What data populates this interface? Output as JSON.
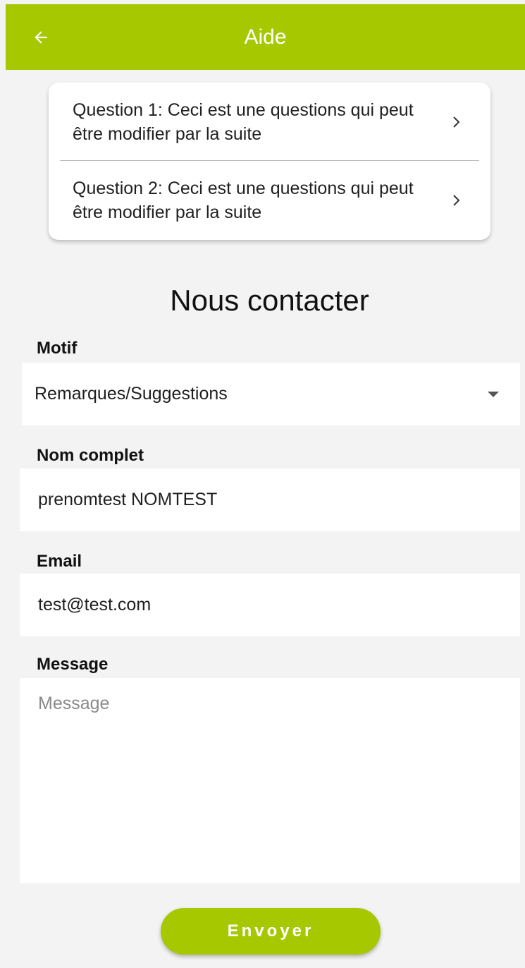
{
  "header": {
    "title": "Aide",
    "back_icon": "arrow-left-icon"
  },
  "faq": {
    "items": [
      {
        "text": "Question 1: Ceci est une questions qui peut être modifier par la suite",
        "icon": "chevron-right-icon"
      },
      {
        "text": "Question 2: Ceci est une questions qui peut être modifier par la suite",
        "icon": "chevron-right-icon"
      }
    ]
  },
  "contact": {
    "title": "Nous contacter",
    "motif": {
      "label": "Motif",
      "value": "Remarques/Suggestions",
      "icon": "dropdown-arrow-icon"
    },
    "name": {
      "label": "Nom complet",
      "value": "prenomtest NOMTEST"
    },
    "email": {
      "label": "Email",
      "value": "test@test.com"
    },
    "message": {
      "label": "Message",
      "placeholder": "Message",
      "value": ""
    },
    "submit_label": "Envoyer"
  },
  "colors": {
    "accent": "#a6c800",
    "background": "#f3f3f3",
    "surface": "#ffffff",
    "text": "#1f1f1f",
    "placeholder": "#8a8a8a"
  }
}
